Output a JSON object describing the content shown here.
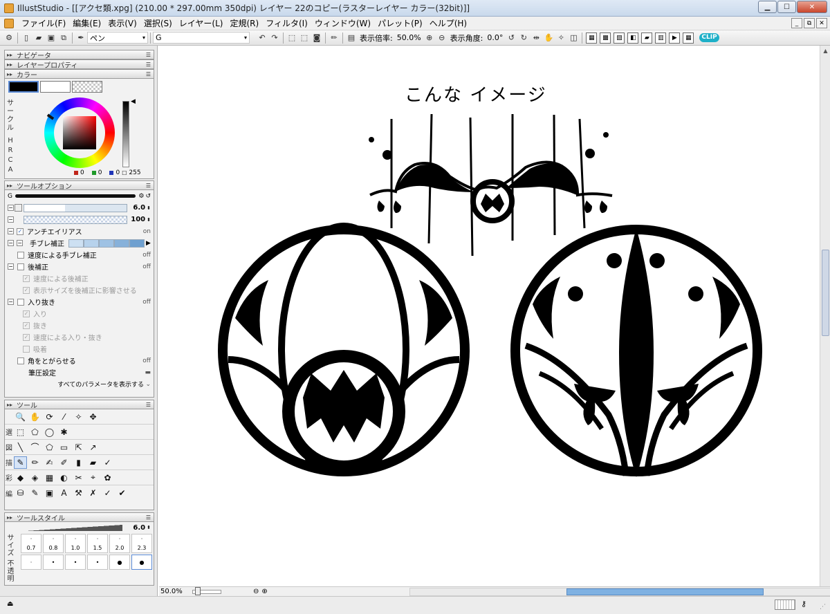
{
  "window": {
    "title": "IllustStudio - [[アクセ類.xpg] (210.00 * 297.00mm 350dpi)   レイヤー 22のコピー(ラスターレイヤー カラー(32bit)]]",
    "minimize": "▁",
    "maximize": "☐",
    "close": "✕"
  },
  "menu": [
    "ファイル(F)",
    "編集(E)",
    "表示(V)",
    "選択(S)",
    "レイヤー(L)",
    "定規(R)",
    "フィルタ(I)",
    "ウィンドウ(W)",
    "パレット(P)",
    "ヘルプ(H)"
  ],
  "mdi_controls": [
    "_",
    "⧉",
    "✕"
  ],
  "toolbar": {
    "tool_name": "ペン",
    "preset": "G",
    "zoom_label": "表示倍率:",
    "zoom_value": "50.0%",
    "angle_label": "表示角度:",
    "angle_value": "0.0°",
    "logo": "CLIP"
  },
  "panels": {
    "navigator": "ナビゲータ",
    "layer_property": "レイヤープロパティ",
    "color": "カラー",
    "tool_options": "ツールオプション",
    "tools": "ツール",
    "tool_style": "ツールスタイル"
  },
  "color": {
    "side_label": "サークル",
    "modes": [
      "H",
      "R",
      "C",
      "A"
    ],
    "r": "0",
    "g": "0",
    "b": "0",
    "opacity": "255",
    "fg": "#000000",
    "bg": "#ffffff"
  },
  "tool_options": {
    "brush_name": "G",
    "size": "6.0",
    "density": "100",
    "antialias": {
      "label": "アンチエイリアス",
      "state": "on"
    },
    "stabilizer": {
      "label": "手ブレ補正"
    },
    "rows": [
      {
        "label": "速度による手ブレ補正",
        "state": "off",
        "enabled": true
      },
      {
        "label": "後補正",
        "state": "off",
        "enabled": true
      },
      {
        "label": "速度による後補正",
        "state": "",
        "enabled": false
      },
      {
        "label": "表示サイズを後補正に影響させる",
        "state": "",
        "enabled": false
      },
      {
        "label": "入り抜き",
        "state": "off",
        "enabled": true
      },
      {
        "label": "入り",
        "state": "",
        "enabled": false
      },
      {
        "label": "抜き",
        "state": "",
        "enabled": false
      },
      {
        "label": "速度による入り・抜き",
        "state": "",
        "enabled": false
      },
      {
        "label": "吸着",
        "state": "",
        "enabled": false
      },
      {
        "label": "角をとがらせる",
        "state": "off",
        "enabled": true
      }
    ],
    "pressure": "筆圧設定",
    "show_all": "すべてのパラメータを表示する"
  },
  "tools": {
    "rows": [
      {
        "label": "",
        "icons": [
          "🔍",
          "✋",
          "⟳",
          "⁄",
          "✧",
          "✥"
        ]
      },
      {
        "label": "選",
        "icons": [
          "⬚",
          "⬠",
          "◯",
          "✱"
        ]
      },
      {
        "label": "図",
        "icons": [
          "╲",
          "⌒",
          "⬠",
          "▭",
          "⇱",
          "↗"
        ]
      },
      {
        "label": "描",
        "icons": [
          "✎",
          "✏",
          "✍",
          "✐",
          "▮",
          "▰",
          "✓"
        ]
      },
      {
        "label": "彩",
        "icons": [
          "◆",
          "◈",
          "▦",
          "◐",
          "✂",
          "⌖",
          "✿"
        ]
      },
      {
        "label": "編",
        "icons": [
          "⛁",
          "✎",
          "▣",
          "A",
          "⚒",
          "✗",
          "✓",
          "✔"
        ]
      }
    ]
  },
  "tool_style": {
    "size": "6.0",
    "side_labels": [
      "サイズ",
      "不透明"
    ],
    "size_presets": [
      "0.7",
      "0.8",
      "1.0",
      "1.5",
      "2.0",
      "2.3"
    ]
  },
  "canvas": {
    "caption": "こんな イメージ"
  },
  "status": {
    "zoom": "50.0%"
  }
}
